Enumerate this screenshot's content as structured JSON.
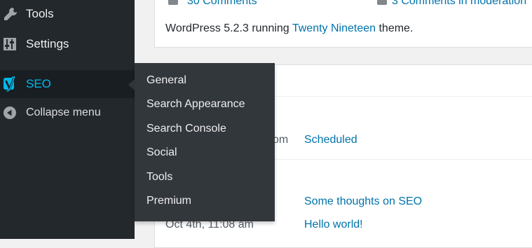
{
  "sidebar": {
    "items": [
      {
        "label": "Tools",
        "icon": "wrench-icon"
      },
      {
        "label": "Settings",
        "icon": "settings-icon"
      },
      {
        "label": "SEO",
        "icon": "yoast-icon"
      },
      {
        "label": "Collapse menu",
        "icon": "collapse-icon"
      }
    ]
  },
  "seo_submenu": {
    "items": [
      "General",
      "Search Appearance",
      "Search Console",
      "Social",
      "Tools",
      "Premium"
    ]
  },
  "at_a_glance": {
    "comments_link": "30 Comments",
    "moderation_link": "3 Comments in moderation",
    "wp_version_prefix": "WordPress 5.2.3 running ",
    "theme_link": "Twenty Nineteen",
    "wp_version_suffix": " theme."
  },
  "activity": {
    "partial_text": "om",
    "scheduled_link": "Scheduled",
    "posts": [
      {
        "date": "",
        "title": "Some thoughts on SEO"
      },
      {
        "date": "Oct 4th, 11:08 am",
        "title": "Hello world!"
      }
    ]
  },
  "colors": {
    "menu_bg": "#23282d",
    "submenu_bg": "#32373c",
    "current_text": "#00b9eb",
    "link": "#0073aa"
  }
}
